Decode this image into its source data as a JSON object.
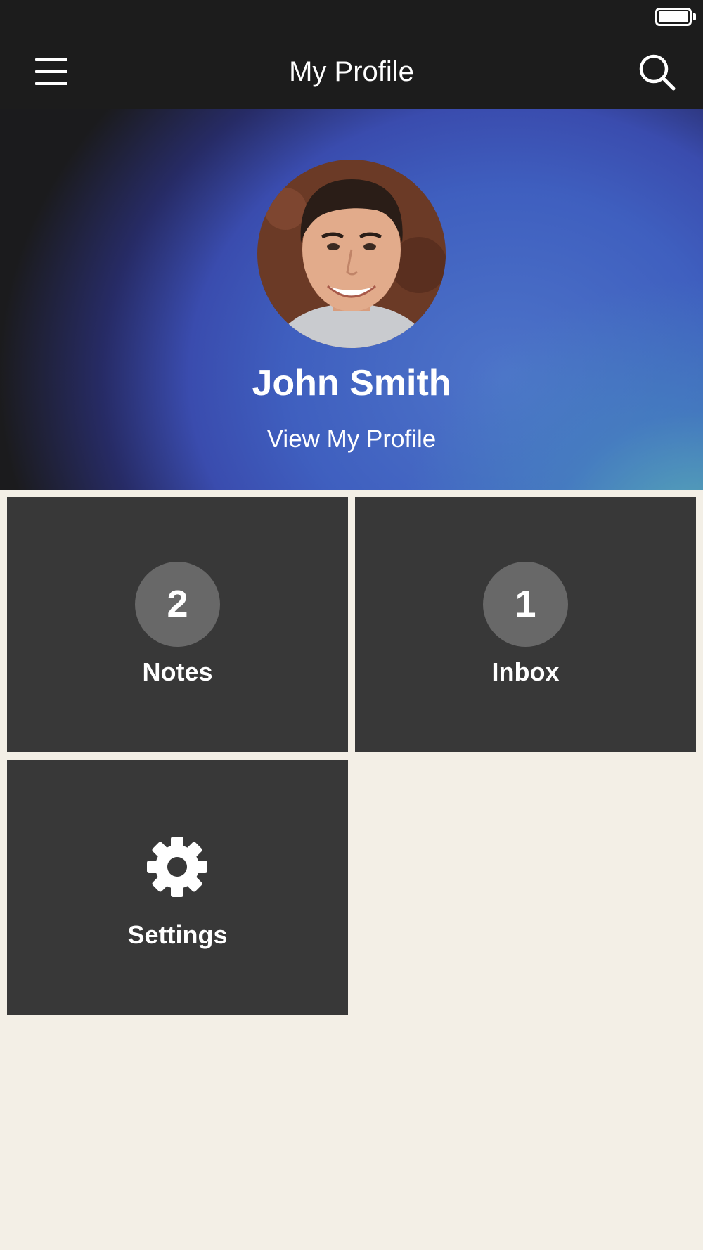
{
  "status_bar": {
    "battery_icon": "battery-full-icon",
    "battery_level": 1.0
  },
  "header": {
    "title": "My Profile",
    "menu_icon": "hamburger-menu-icon",
    "search_icon": "search-icon"
  },
  "profile": {
    "name": "John Smith",
    "link_label": "View My Profile",
    "avatar": "avatar-photo"
  },
  "tiles": [
    {
      "label": "Notes",
      "count": "2"
    },
    {
      "label": "Inbox",
      "count": "1"
    },
    {
      "label": "Settings",
      "icon": "gear-icon"
    }
  ],
  "colors": {
    "header_bg": "#1c1c1c",
    "page_bg": "#f3efe6",
    "tile_bg": "#383838",
    "badge_bg": "#686868",
    "hero_blue": "#3f5fbf",
    "hero_teal": "#5fbeb4"
  }
}
